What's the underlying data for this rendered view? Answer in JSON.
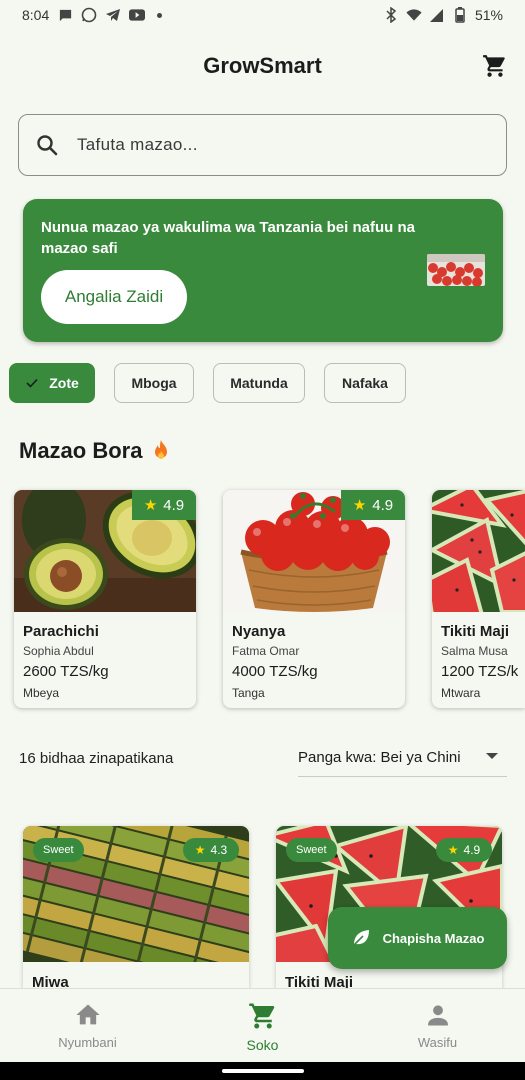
{
  "status_bar": {
    "time": "8:04",
    "battery": "51%"
  },
  "app": {
    "title": "GrowSmart"
  },
  "search": {
    "placeholder": "Tafuta mazao..."
  },
  "banner": {
    "text": "Nunua mazao ya wakulima wa Tanzania bei nafuu na mazao safi",
    "button": "Angalia Zaidi"
  },
  "chips": [
    {
      "label": "Zote",
      "selected": true
    },
    {
      "label": "Mboga",
      "selected": false
    },
    {
      "label": "Matunda",
      "selected": false
    },
    {
      "label": "Nafaka",
      "selected": false
    }
  ],
  "featured": {
    "title": "Mazao Bora",
    "items": [
      {
        "name": "Parachichi",
        "seller": "Sophia Abdul",
        "price": "2600 TZS/kg",
        "location": "Mbeya",
        "rating": "4.9",
        "image": "avocado"
      },
      {
        "name": "Nyanya",
        "seller": "Fatma Omar",
        "price": "4000 TZS/kg",
        "location": "Tanga",
        "rating": "4.9",
        "image": "tomatoes"
      },
      {
        "name": "Tikiti Maji",
        "seller": "Salma Musa",
        "price": "1200 TZS/k",
        "location": "Mtwara",
        "rating": "",
        "image": "watermelon"
      }
    ]
  },
  "results": {
    "count_text": "16 bidhaa zinapatikana",
    "sort_label": "Panga kwa: Bei ya Chini"
  },
  "grid": [
    {
      "name": "Miwa",
      "tag": "Sweet",
      "rating": "4.3",
      "image": "sugarcane"
    },
    {
      "name": "Tikiti Maji",
      "tag": "Sweet",
      "rating": "4.9",
      "image": "watermelon"
    }
  ],
  "fab": {
    "label": "Chapisha Mazao"
  },
  "bottom_nav": [
    {
      "label": "Nyumbani",
      "icon": "home-icon",
      "active": false
    },
    {
      "label": "Soko",
      "icon": "cart-icon",
      "active": true
    },
    {
      "label": "Wasifu",
      "icon": "person-icon",
      "active": false
    }
  ],
  "colors": {
    "primary": "#3a8a3e",
    "background": "#f4f8f0"
  }
}
